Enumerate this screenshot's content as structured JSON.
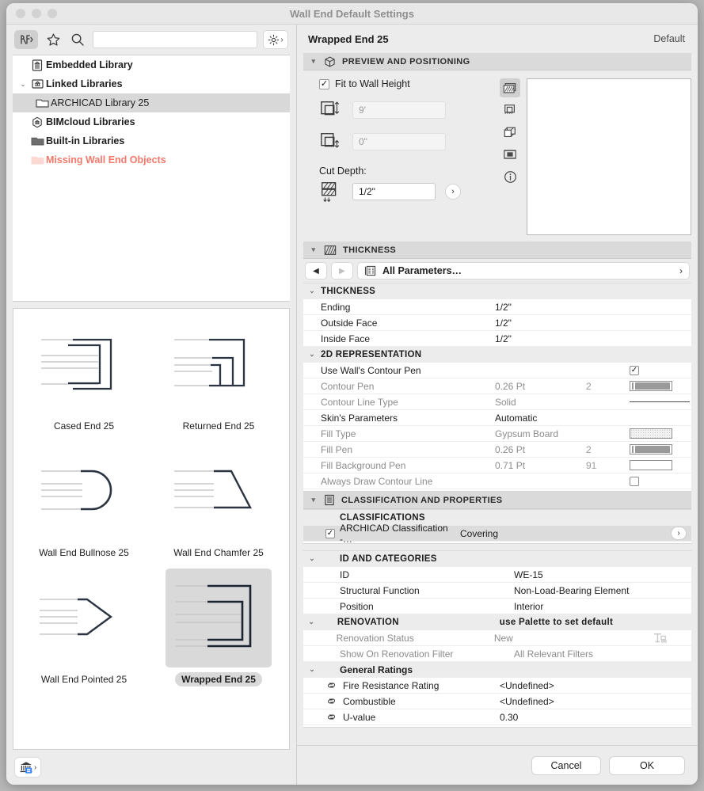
{
  "window": {
    "title": "Wall End Default Settings"
  },
  "toolbar": {
    "browse_icon": "library-part-icon",
    "favorites_icon": "star-icon",
    "search_icon": "search-icon",
    "search_placeholder": "",
    "search_value": "",
    "settings_icon": "gear-icon"
  },
  "library_tree": {
    "items": [
      {
        "label": "Embedded Library",
        "icon": "embedded-library-icon",
        "indent": 0,
        "twist": "",
        "selected": false,
        "bold": true,
        "missing": false
      },
      {
        "label": "Linked Libraries",
        "icon": "linked-library-icon",
        "indent": 0,
        "twist": "⌄",
        "selected": false,
        "bold": true,
        "missing": false
      },
      {
        "label": "ARCHICAD Library 25",
        "icon": "folder-outline-icon",
        "indent": 1,
        "twist": "",
        "selected": true,
        "bold": false,
        "missing": false
      },
      {
        "label": "BIMcloud Libraries",
        "icon": "bimcloud-icon",
        "indent": 0,
        "twist": "",
        "selected": false,
        "bold": true,
        "missing": false
      },
      {
        "label": "Built-in Libraries",
        "icon": "folder-filled-icon",
        "indent": 0,
        "twist": "",
        "selected": false,
        "bold": true,
        "missing": false
      },
      {
        "label": "Missing Wall End Objects",
        "icon": "folder-missing-icon",
        "indent": 0,
        "twist": "",
        "selected": false,
        "bold": true,
        "missing": true
      }
    ]
  },
  "thumbnails": {
    "items": [
      {
        "label": "Cased End 25",
        "art": "cased-end",
        "selected": false
      },
      {
        "label": "Returned End 25",
        "art": "returned-end",
        "selected": false
      },
      {
        "label": "Wall End Bullnose 25",
        "art": "bullnose",
        "selected": false
      },
      {
        "label": "Wall End Chamfer 25",
        "art": "chamfer",
        "selected": false
      },
      {
        "label": "Wall End Pointed 25",
        "art": "pointed",
        "selected": false
      },
      {
        "label": "Wrapped End 25",
        "art": "wrapped",
        "selected": true
      }
    ]
  },
  "left_footer": {
    "icon": "library-manager-icon"
  },
  "header": {
    "object_name": "Wrapped End 25",
    "default_label": "Default"
  },
  "preview_section": {
    "title": "PREVIEW AND POSITIONING",
    "icon": "3d-box-icon",
    "fit_to_wall_height": {
      "label": "Fit to Wall Height",
      "checked": true
    },
    "height_field": {
      "icon": "wall-height-icon",
      "value": "9'",
      "disabled": true
    },
    "offset_field": {
      "icon": "wall-offset-icon",
      "value": "0\"",
      "disabled": true
    },
    "cut_depth_label": "Cut Depth:",
    "cut_depth_field": {
      "icon": "cut-depth-icon",
      "value": "1/2\"",
      "disabled": false
    },
    "cut_depth_more": "›",
    "view_buttons": [
      {
        "icon": "2d-symbol-icon",
        "active": true
      },
      {
        "icon": "2d-full-view-icon",
        "active": false
      },
      {
        "icon": "3d-view-icon",
        "active": false
      },
      {
        "icon": "elevation-view-icon",
        "active": false
      },
      {
        "icon": "info-icon",
        "active": false
      }
    ]
  },
  "thickness_section": {
    "title": "THICKNESS",
    "icon": "thickness-hatch-icon"
  },
  "param_nav": {
    "back": "◀",
    "forward": "▶",
    "label": "All Parameters…",
    "list_icon": "parameter-list-icon",
    "more": "›"
  },
  "parameters": [
    {
      "type": "group",
      "twist": "⌄",
      "name": "THICKNESS"
    },
    {
      "type": "row",
      "name": "Ending",
      "value": "1/2\""
    },
    {
      "type": "row",
      "name": "Outside Face",
      "value": "1/2\""
    },
    {
      "type": "row",
      "name": "Inside Face",
      "value": "1/2\""
    },
    {
      "type": "group",
      "twist": "⌄",
      "name": "2D REPRESENTATION"
    },
    {
      "type": "row",
      "name": "Use Wall's Contour Pen",
      "value": "",
      "checkbox": true,
      "checked": true
    },
    {
      "type": "row",
      "name": "Contour Pen",
      "value": "0.26 Pt",
      "num": "2",
      "swatch": "pen",
      "dim": true
    },
    {
      "type": "row",
      "name": "Contour Line Type",
      "value": "Solid",
      "num": "",
      "swatch": "line",
      "dim": true
    },
    {
      "type": "row",
      "name": "Skin's Parameters",
      "value": "Automatic"
    },
    {
      "type": "row",
      "name": "Fill Type",
      "value": "Gypsum Board",
      "num": "",
      "swatch": "fill",
      "dim": true
    },
    {
      "type": "row",
      "name": "Fill Pen",
      "value": "0.26 Pt",
      "num": "2",
      "swatch": "pen",
      "dim": true
    },
    {
      "type": "row",
      "name": "Fill Background Pen",
      "value": "0.71 Pt",
      "num": "91",
      "swatch": "penempty",
      "dim": true
    },
    {
      "type": "row",
      "name": "Always Draw Contour Line",
      "value": "",
      "checkbox": true,
      "checked": false,
      "dim": true
    }
  ],
  "classification_section": {
    "title": "CLASSIFICATION AND PROPERTIES",
    "icon": "classification-doc-icon"
  },
  "classification_rows": [
    {
      "type": "group",
      "twist": "",
      "name": "CLASSIFICATIONS"
    },
    {
      "type": "row",
      "name": "ARCHICAD Classification -…",
      "value": "Covering",
      "checkbox": true,
      "checked": true,
      "selected": true,
      "arrow": "›"
    }
  ],
  "id_categories": [
    {
      "type": "group",
      "twist": "⌄",
      "name": "ID AND CATEGORIES"
    },
    {
      "type": "row",
      "name": "ID",
      "value": "WE-15"
    },
    {
      "type": "row",
      "name": "Structural Function",
      "value": "Non-Load-Bearing Element"
    },
    {
      "type": "row",
      "name": "Position",
      "value": "Interior"
    },
    {
      "type": "group",
      "twist": "⌄",
      "name": "RENOVATION",
      "value": "use Palette to set default"
    },
    {
      "type": "row",
      "name": "Renovation Status",
      "value": "New",
      "dim": true,
      "trailing_icon": "renovation-palette-icon"
    },
    {
      "type": "row",
      "name": "Show On Renovation Filter",
      "value": "All Relevant Filters",
      "dim": true
    },
    {
      "type": "groupsub",
      "twist": "⌄",
      "name": "General Ratings"
    },
    {
      "type": "row",
      "name": "Fire Resistance Rating",
      "value": "<Undefined>",
      "icon": "property-link-icon"
    },
    {
      "type": "row",
      "name": "Combustible",
      "value": "<Undefined>",
      "icon": "property-link-icon"
    },
    {
      "type": "row",
      "name": "U-value",
      "value": "0.30",
      "icon": "property-link-icon"
    }
  ],
  "footer": {
    "cancel_label": "Cancel",
    "ok_label": "OK"
  },
  "colors": {
    "window_bg": "#ececec",
    "panel_white": "#ffffff",
    "section_header": "#dadada",
    "selection": "#d8d8d8",
    "missing_red": "#f2796b",
    "title_gray": "#8e8e8e",
    "dim_text": "#8c8c8c",
    "line_dark": "#2b3440"
  }
}
